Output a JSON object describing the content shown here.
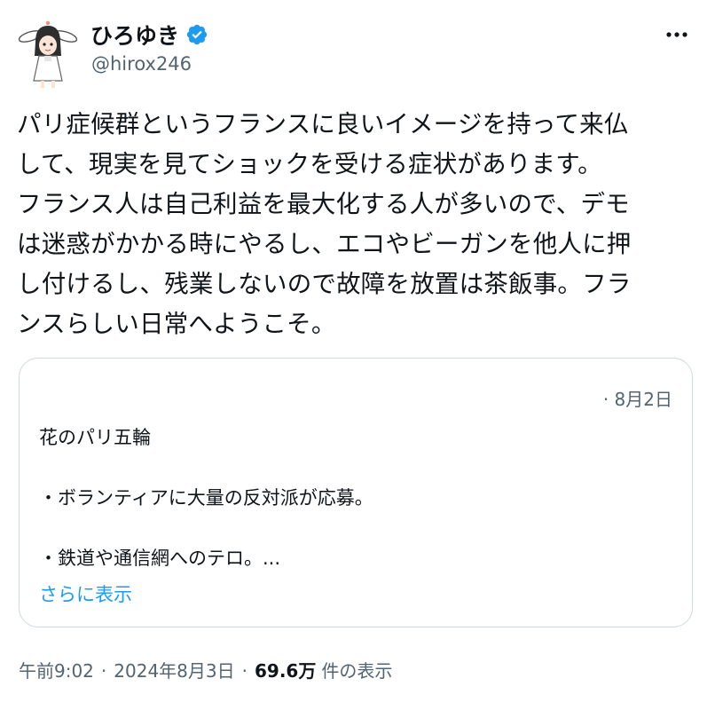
{
  "author": {
    "display_name": "ひろゆき",
    "handle": "@hirox246",
    "verified_color": "#1d9bf0"
  },
  "tweet": {
    "text": "パリ症候群というフランスに良いイメージを持って来仏\nして、現実を見てショックを受ける症状があります。\nフランス人は自己利益を最大化する人が多いので、デモ\nは迷惑がかかる時にやるし、エコやビーガンを他人に押\nし付けるし、残業しないので故障を放置は茶飯事。フラ\nンスらしい日常へようこそ。"
  },
  "quote": {
    "date": "· 8月2日",
    "lines": [
      "花のパリ五輪",
      "",
      "・ボランティアに大量の反対派が応募。",
      "",
      "・鉄道や通信網へのテロ。..."
    ],
    "show_more": "さらに表示"
  },
  "meta": {
    "time": "午前9:02",
    "separator": "·",
    "date": "2024年8月3日",
    "views_count": "69.6万",
    "views_label": "件の表示"
  },
  "icons": {
    "more": "more-horizontal-icon",
    "verified": "verified-badge-icon"
  }
}
